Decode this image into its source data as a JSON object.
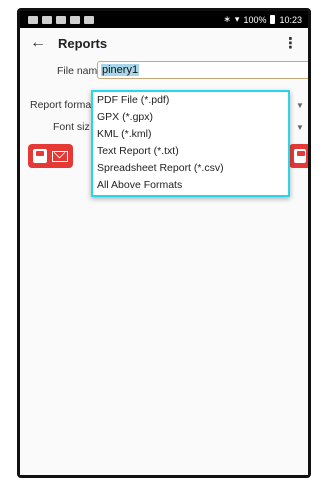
{
  "status_bar": {
    "battery": "100%",
    "time": "10:23"
  },
  "app_bar": {
    "title": "Reports"
  },
  "form": {
    "file_name_label": "File name:",
    "file_name_value": "pinery1",
    "report_format_label": "Report forma",
    "font_size_label": "Font siz"
  },
  "dropdown": {
    "options": [
      "PDF File (*.pdf)",
      "GPX (*.gpx)",
      "KML (*.kml)",
      "Text Report (*.txt)",
      "Spreadsheet Report (*.csv)",
      "All Above Formats"
    ]
  },
  "colors": {
    "accent_red": "#e53935",
    "dropdown_border": "#28d6e8"
  }
}
